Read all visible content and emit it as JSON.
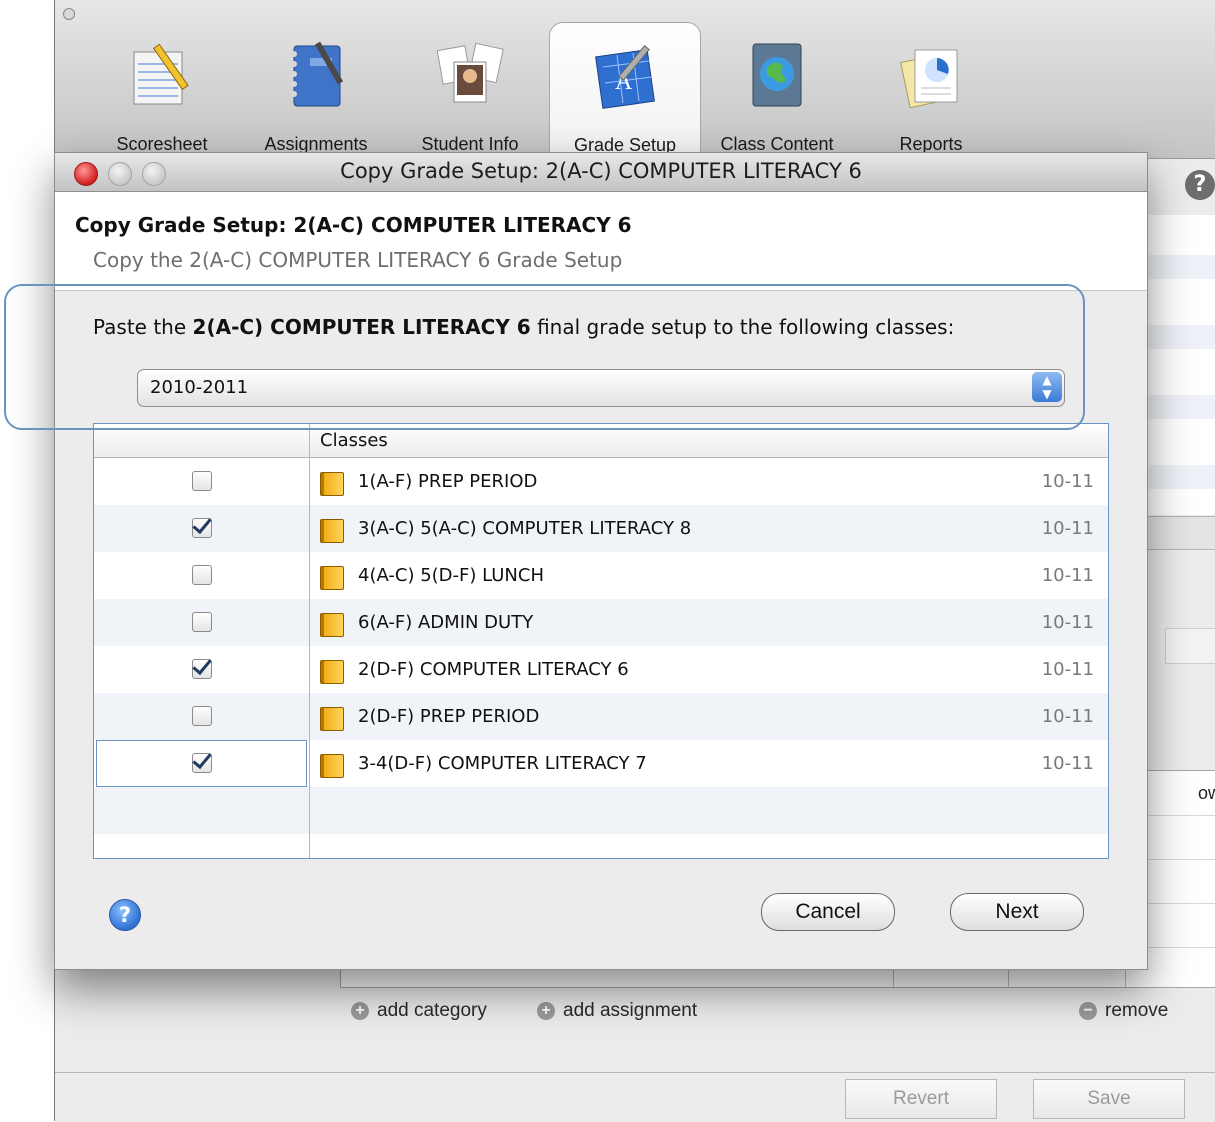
{
  "toolbar": {
    "items": [
      {
        "label": "Scoresheet",
        "icon": "scoresheet-icon"
      },
      {
        "label": "Assignments",
        "icon": "notebook-icon"
      },
      {
        "label": "Student Info",
        "icon": "photos-icon"
      },
      {
        "label": "Grade Setup",
        "icon": "grade-setup-icon",
        "selected": true
      },
      {
        "label": "Class Content",
        "icon": "globe-book-icon"
      },
      {
        "label": "Reports",
        "icon": "reports-icon"
      }
    ]
  },
  "background": {
    "grid_header_partial": "ow",
    "add_category": "add category",
    "add_assignment": "add assignment",
    "remove": "remove",
    "revert_label": "Revert",
    "save_label": "Save",
    "help_symbol": "?"
  },
  "dialog": {
    "window_title": "Copy Grade Setup: 2(A-C) COMPUTER LITERACY 6",
    "heading": "Copy Grade Setup: 2(A-C) COMPUTER LITERACY 6",
    "subheading": "Copy the 2(A-C) COMPUTER LITERACY 6 Grade Setup",
    "instruction_prefix": "Paste the ",
    "instruction_class": "2(A-C) COMPUTER LITERACY 6",
    "instruction_suffix": " final grade setup to the following classes:",
    "year_select": {
      "selected": "2010-2011"
    },
    "table": {
      "column_header": "Classes",
      "rows": [
        {
          "name": "1(A-F) PREP PERIOD",
          "term": "10-11",
          "checked": false
        },
        {
          "name": "3(A-C) 5(A-C) COMPUTER LITERACY 8",
          "term": "10-11",
          "checked": true
        },
        {
          "name": "4(A-C) 5(D-F) LUNCH",
          "term": "10-11",
          "checked": false
        },
        {
          "name": "6(A-F) ADMIN DUTY",
          "term": "10-11",
          "checked": false
        },
        {
          "name": "2(D-F) COMPUTER LITERACY 6",
          "term": "10-11",
          "checked": true
        },
        {
          "name": "2(D-F) PREP PERIOD",
          "term": "10-11",
          "checked": false
        },
        {
          "name": "3-4(D-F) COMPUTER LITERACY 7",
          "term": "10-11",
          "checked": true
        }
      ]
    },
    "help_symbol": "?",
    "cancel_label": "Cancel",
    "next_label": "Next"
  }
}
